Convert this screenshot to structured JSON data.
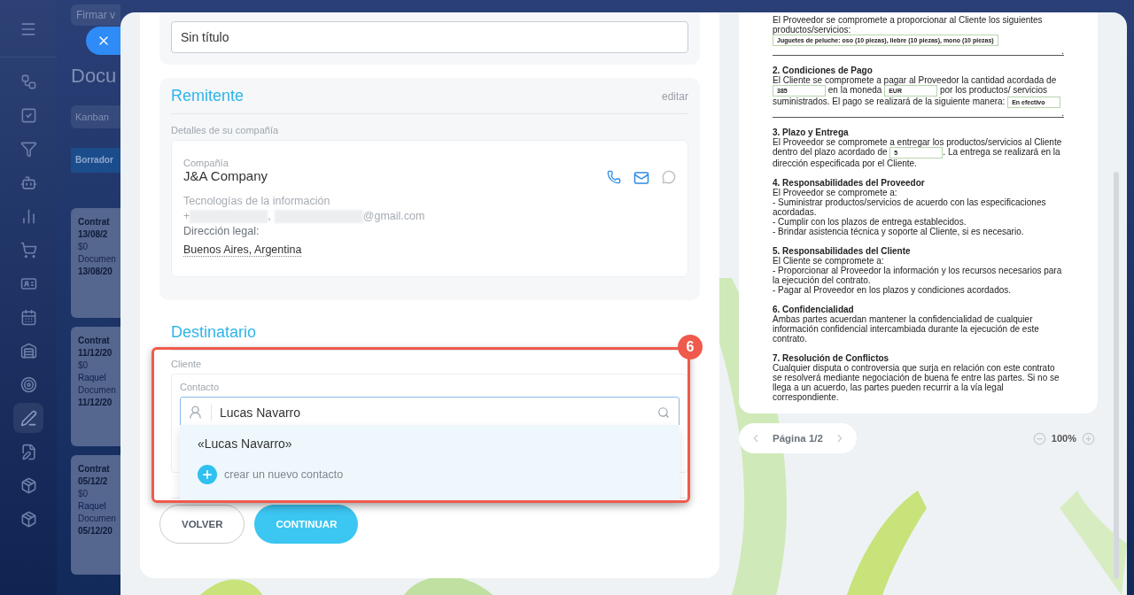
{
  "sidebar": {
    "items": [
      {
        "selected": false
      },
      {
        "selected": false
      },
      {
        "selected": false
      },
      {
        "selected": false
      },
      {
        "selected": false
      },
      {
        "selected": false
      },
      {
        "selected": false
      },
      {
        "selected": false
      },
      {
        "selected": false
      },
      {
        "selected": false
      },
      {
        "selected": true
      },
      {
        "selected": false
      },
      {
        "selected": false
      },
      {
        "selected": false
      }
    ]
  },
  "background_page": {
    "search": "Firmar v",
    "title": "Docu",
    "view_button": "Kanban",
    "column_header": "Borrador",
    "cards": [
      {
        "title": "Contrat",
        "date": "13/08/2",
        "amount": "$0",
        "label": "Documen",
        "date2": "13/08/20"
      },
      {
        "title": "Contrat",
        "date": "11/12/20",
        "amount": "$0",
        "person": "Raquel",
        "label": "Documen",
        "date2": "11/12/20"
      },
      {
        "title": "Contrat",
        "date": "05/12/2",
        "amount": "$0",
        "person": "Raquel",
        "label": "Documen",
        "date2": "05/12/20"
      }
    ]
  },
  "form": {
    "document_title": {
      "value": "Sin título"
    },
    "sender": {
      "title": "Remitente",
      "edit_link": "editar",
      "details_label": "Detalles de su compañía",
      "company_label": "Compañía",
      "company_name": "J&A Company",
      "industry": "Tecnologías de la información",
      "phone_prefix": "+",
      "separator": ",",
      "email_suffix": "@gmail.com",
      "address_label": "Dirección legal:",
      "address": "Buenos Aires, Argentina"
    },
    "recipient": {
      "title": "Destinatario",
      "client_label": "Cliente",
      "contact_label": "Contacto",
      "contact_value": "Lucas Navarro",
      "suggestions": [
        {
          "kind": "match",
          "text": "«Lucas Navarro»"
        },
        {
          "kind": "create",
          "text": "crear un nuevo contacto"
        }
      ],
      "callout": "6"
    },
    "buttons": [
      {
        "kind": "secondary",
        "label": "VOLVER"
      },
      {
        "kind": "primary",
        "label": "CONTINUAR"
      }
    ]
  },
  "document": {
    "sections": [
      {
        "paragraphs": [
          {
            "parts": [
              {
                "kind": "text",
                "text": "El Proveedor se compromete a proporcionar al Cliente los siguientes productos/servicios: "
              },
              {
                "kind": "field",
                "text": "Juguetes de peluche: oso (10 piezas), liebre (10 piezas), mono (10 piezas)"
              },
              {
                "kind": "rule",
                "text": "."
              }
            ]
          }
        ]
      },
      {
        "heading": "2. Condiciones de Pago",
        "paragraphs": [
          {
            "parts": [
              {
                "kind": "text",
                "text": "El Cliente se compromete a pagar al Proveedor la cantidad acordada de "
              },
              {
                "kind": "field",
                "text": "385"
              },
              {
                "kind": "text",
                "text": " en la moneda "
              },
              {
                "kind": "field",
                "text": "EUR"
              },
              {
                "kind": "text",
                "text": " por los productos/ servicios suministrados. El pago se realizará de la siguiente manera: "
              },
              {
                "kind": "field",
                "text": "En efectivo"
              },
              {
                "kind": "rule",
                "text": "."
              }
            ]
          }
        ]
      },
      {
        "heading": "3. Plazo y Entrega",
        "paragraphs": [
          {
            "parts": [
              {
                "kind": "text",
                "text": "El Proveedor se compromete a entregar los productos/servicios al Cliente dentro del plazo acordado de "
              },
              {
                "kind": "field",
                "text": "5"
              },
              {
                "kind": "text",
                "text": ". La entrega se realizará en la dirección especificada por el Cliente."
              }
            ]
          }
        ]
      },
      {
        "heading": "4. Responsabilidades del Proveedor",
        "paragraphs": [
          {
            "parts": [
              {
                "kind": "text",
                "text": "El Proveedor se compromete a:"
              }
            ]
          },
          {
            "parts": [
              {
                "kind": "text",
                "text": "- Suministrar productos/servicios de acuerdo con las especificaciones acordadas."
              }
            ]
          },
          {
            "parts": [
              {
                "kind": "text",
                "text": "- Cumplir con los plazos de entrega establecidos."
              }
            ]
          },
          {
            "parts": [
              {
                "kind": "text",
                "text": "- Brindar asistencia técnica y soporte al Cliente, si es necesario."
              }
            ]
          }
        ]
      },
      {
        "heading": "5. Responsabilidades del Cliente",
        "paragraphs": [
          {
            "parts": [
              {
                "kind": "text",
                "text": "El Cliente se compromete a:"
              }
            ]
          },
          {
            "parts": [
              {
                "kind": "text",
                "text": "- Proporcionar al Proveedor la información y los recursos necesarios para la ejecución del contrato."
              }
            ]
          },
          {
            "parts": [
              {
                "kind": "text",
                "text": "- Pagar al Proveedor en los plazos y condiciones acordados."
              }
            ]
          }
        ]
      },
      {
        "heading": "6. Confidencialidad",
        "paragraphs": [
          {
            "parts": [
              {
                "kind": "text",
                "text": "Ambas partes acuerdan mantener la confidencialidad de cualquier información confidencial intercambiada durante la ejecución de este contrato."
              }
            ]
          }
        ]
      },
      {
        "heading": "7. Resolución de Conflictos",
        "paragraphs": [
          {
            "parts": [
              {
                "kind": "text",
                "text": "Cualquier disputa o controversia que surja en relación con este contrato se resolverá mediante negociación de buena fe entre las partes. Si no se llega a un acuerdo, las partes pueden recurrir a la vía legal correspondiente."
              }
            ]
          }
        ]
      }
    ],
    "pagination": "Página 1/2",
    "zoom": "100%"
  }
}
